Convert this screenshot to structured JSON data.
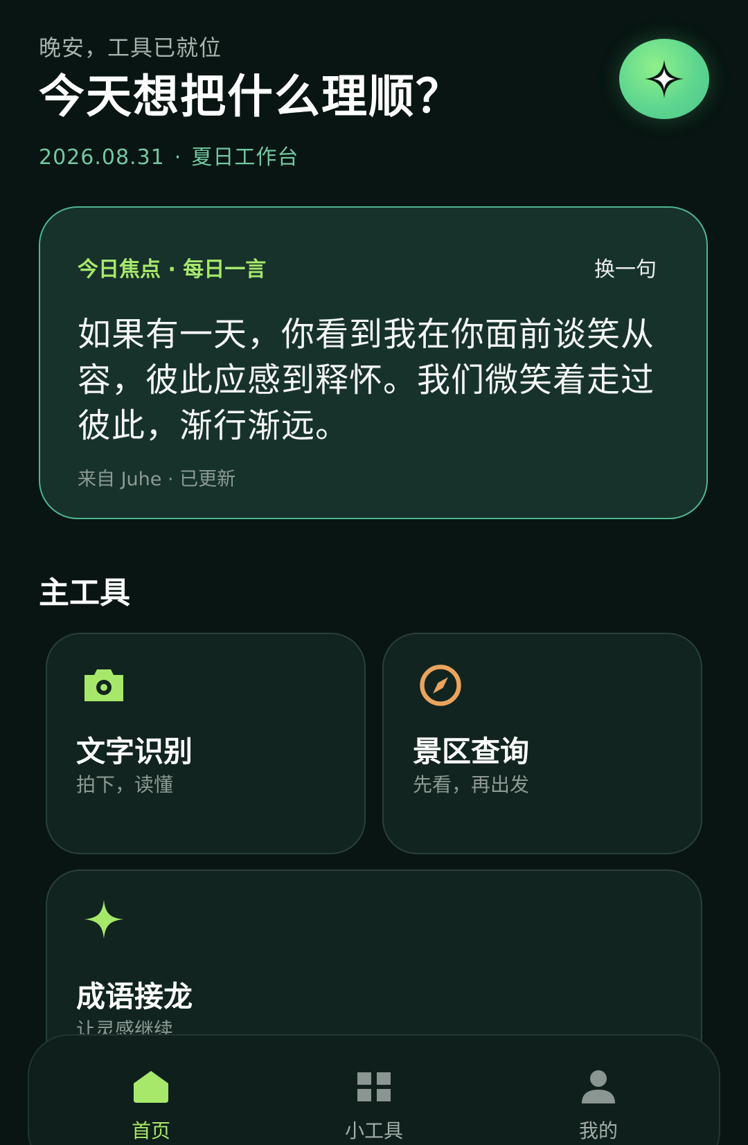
{
  "header": {
    "greeting": "晚安，工具已就位",
    "headline": "今天想把什么理顺？",
    "date": "2026.08.31",
    "separator": "·",
    "workspace": "夏日工作台",
    "action_icon": "sparkle-icon"
  },
  "quote_card": {
    "tag": "今日焦点 · 每日一言",
    "refresh_label": "换一句",
    "text": "如果有一天，你看到我在你面前谈笑从容，彼此应感到释怀。我们微笑着走过彼此，渐行渐远。",
    "source": "来自 Juhe · 已更新"
  },
  "main_tools": {
    "title": "主工具",
    "items": [
      {
        "title": "文字识别",
        "subtitle": "拍下，读懂",
        "icon": "camera-icon",
        "color": "#a7e86b"
      },
      {
        "title": "景区查询",
        "subtitle": "先看，再出发",
        "icon": "compass-icon",
        "color": "#eba45e"
      },
      {
        "title": "成语接龙",
        "subtitle": "让灵感继续",
        "icon": "sparkle-icon",
        "color": "#a7e86b"
      }
    ]
  },
  "bottom_nav": {
    "items": [
      {
        "label": "首页",
        "icon": "home-icon",
        "active": true
      },
      {
        "label": "小工具",
        "icon": "grid-icon",
        "active": false
      },
      {
        "label": "我的",
        "icon": "person-icon",
        "active": false
      }
    ]
  },
  "colors": {
    "background": "#081512",
    "accent_green": "#a7e86b",
    "accent_orange": "#eba45e",
    "card_border": "#4fb58f",
    "date_teal": "#72c8a2"
  }
}
